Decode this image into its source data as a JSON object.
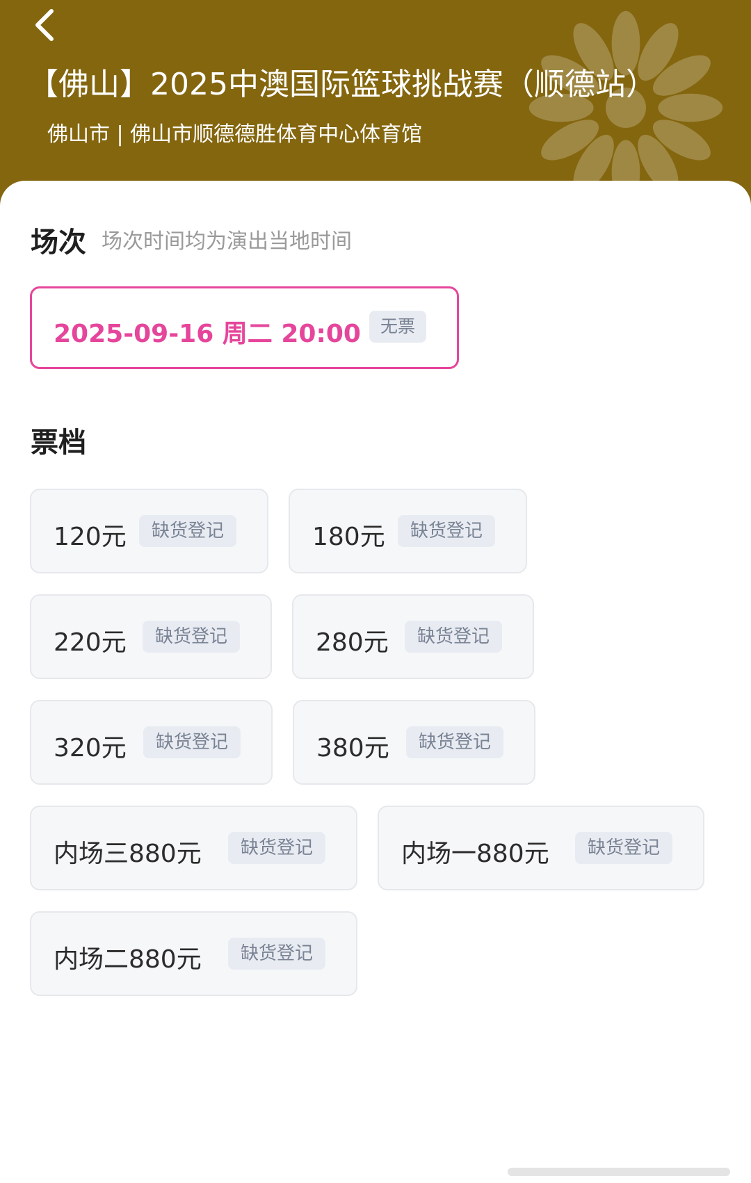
{
  "header": {
    "title": "【佛山】2025中澳国际篮球挑战赛（顺德站）",
    "subtitle": "佛山市 | 佛山市顺德德胜体育中心体育馆",
    "background_color": "#84660f"
  },
  "sessions": {
    "title": "场次",
    "note": "场次时间均为演出当地时间",
    "items": [
      {
        "label": "2025-09-16 周二 20:00",
        "tag": "无票",
        "selected": true
      }
    ]
  },
  "tiers": {
    "title": "票档",
    "items": [
      {
        "price": "120元",
        "tag": "缺货登记"
      },
      {
        "price": "180元",
        "tag": "缺货登记"
      },
      {
        "price": "220元",
        "tag": "缺货登记"
      },
      {
        "price": "280元",
        "tag": "缺货登记"
      },
      {
        "price": "320元",
        "tag": "缺货登记"
      },
      {
        "price": "380元",
        "tag": "缺货登记"
      },
      {
        "price": "内场三880元",
        "tag": "缺货登记"
      },
      {
        "price": "内场一880元",
        "tag": "缺货登记"
      },
      {
        "price": "内场二880元",
        "tag": "缺货登记"
      }
    ]
  },
  "icons": {
    "back": "chevron-left-icon",
    "decoration": "flower-watermark-icon"
  },
  "colors": {
    "accent": "#e5469b",
    "tag_bg": "#e8ecf2",
    "tag_text": "#7a8394"
  }
}
